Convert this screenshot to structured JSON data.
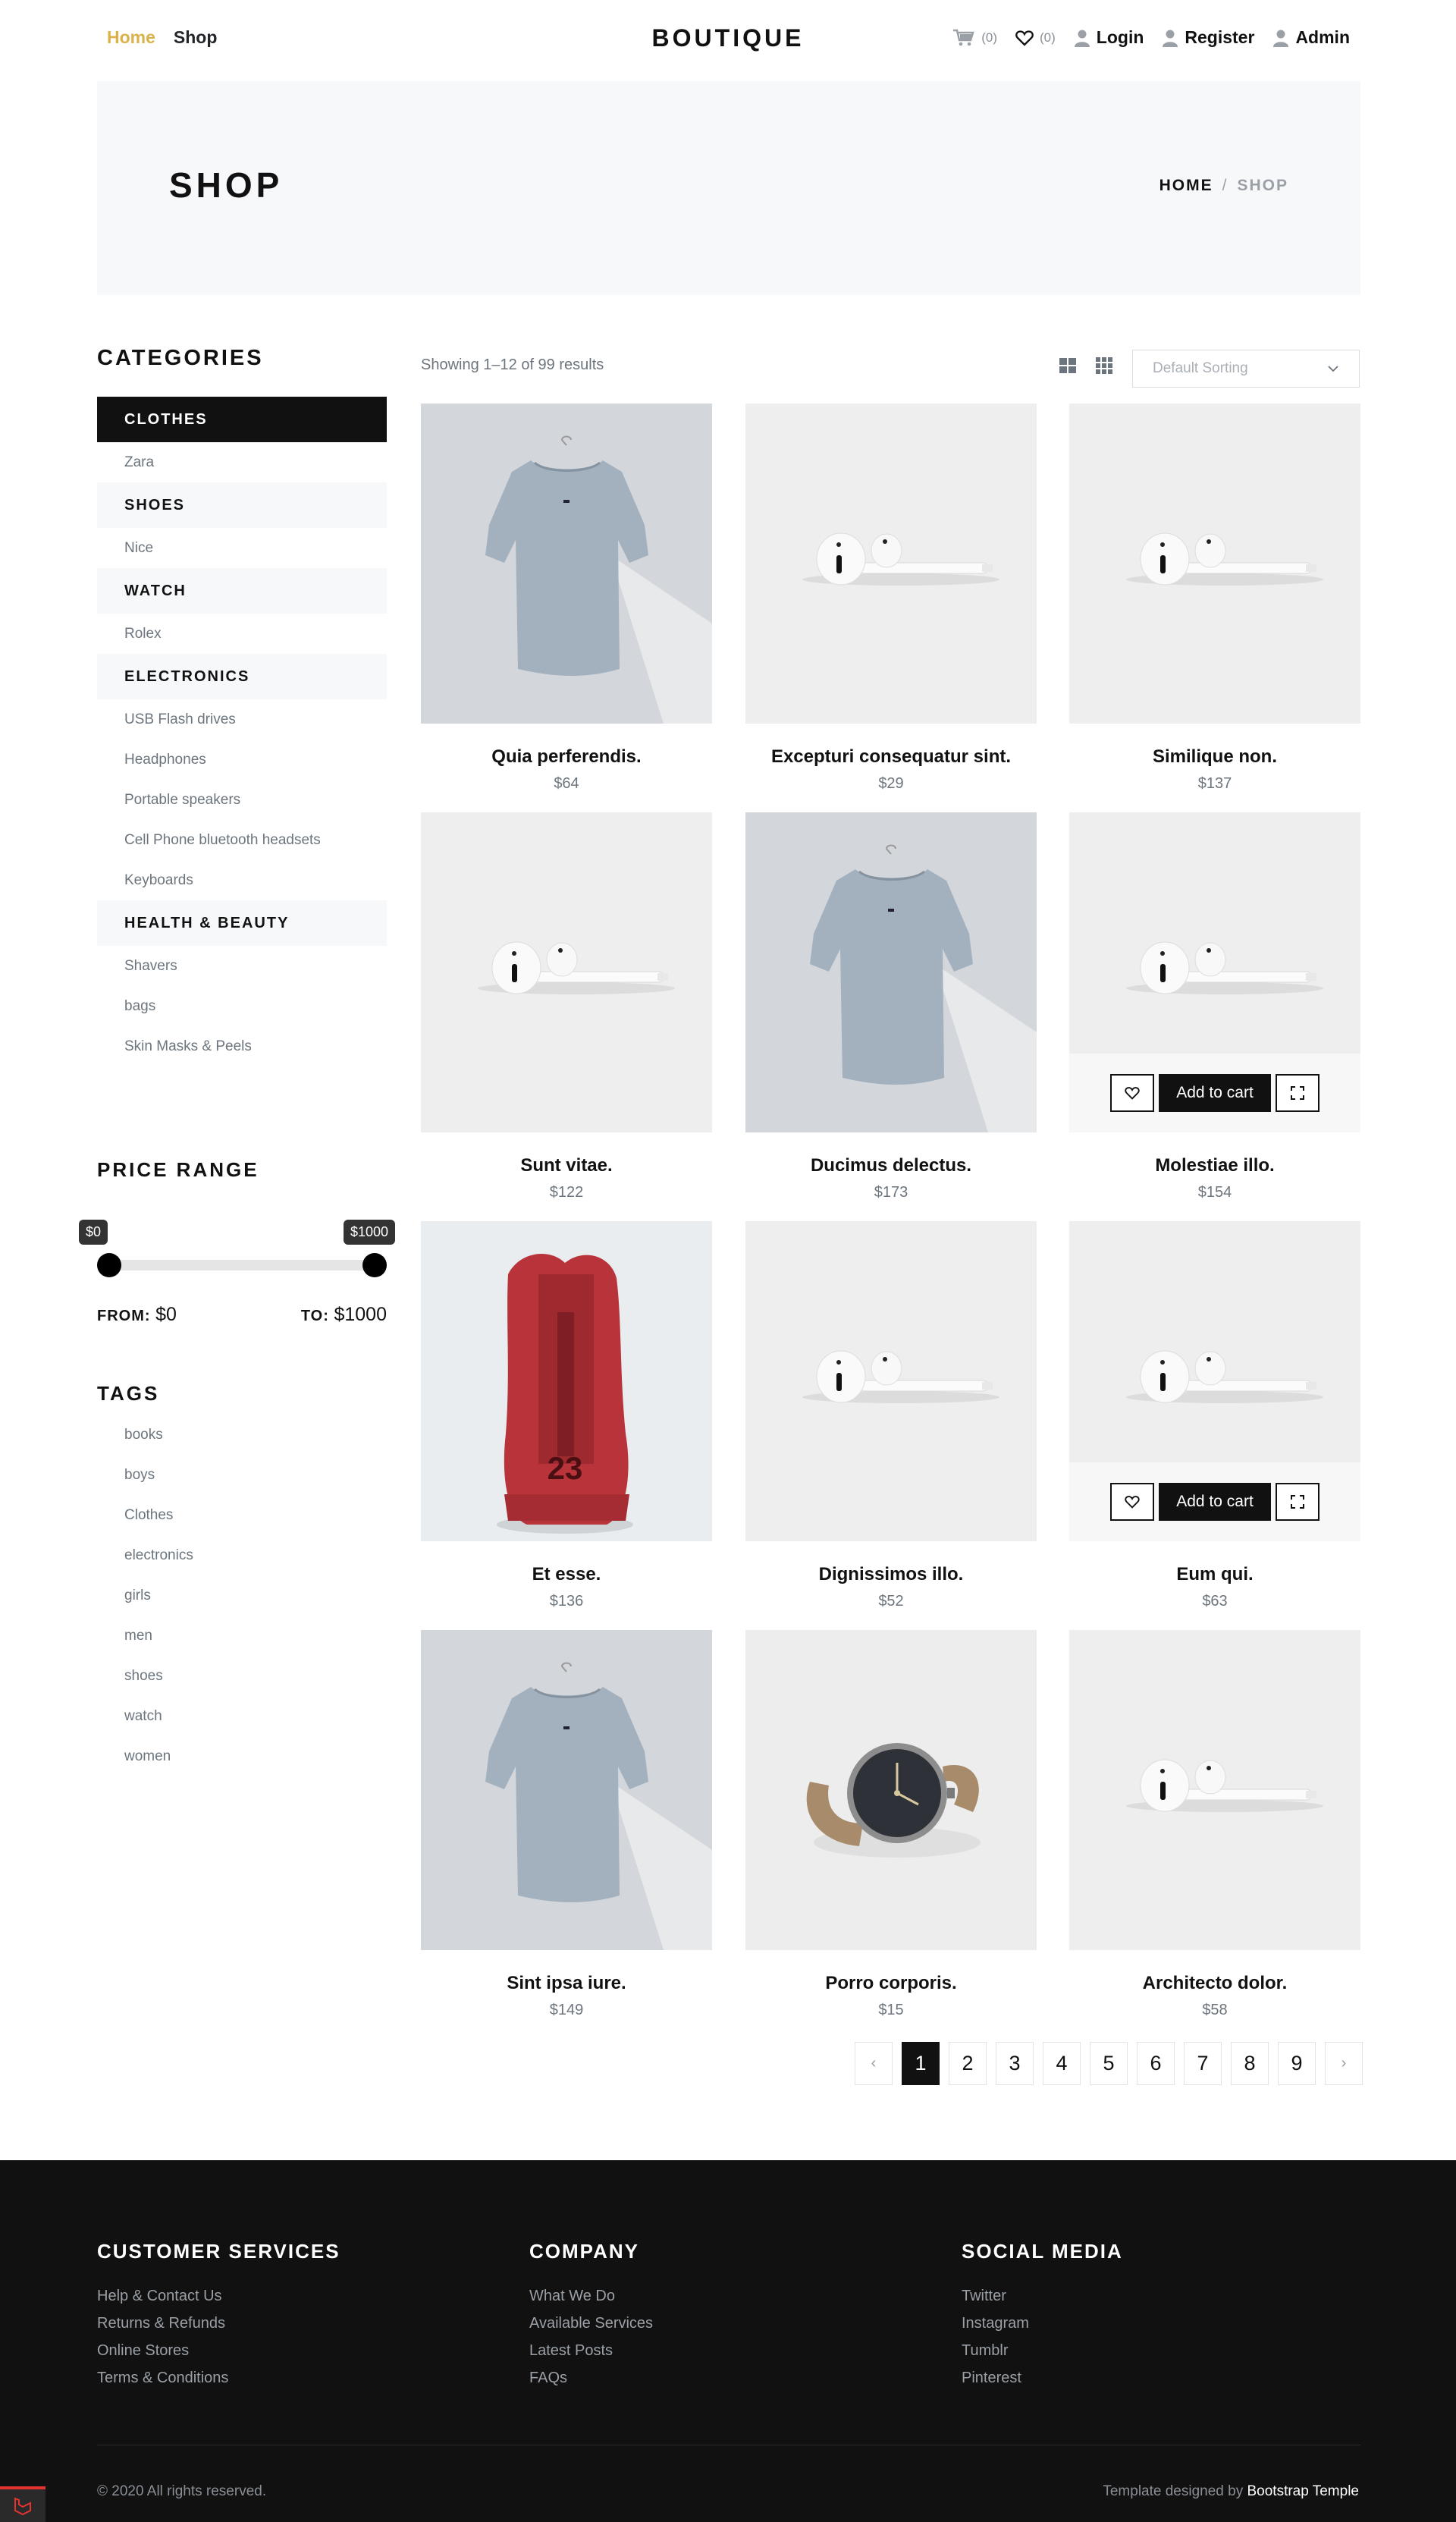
{
  "nav": {
    "home": "Home",
    "shop": "Shop",
    "brand": "BOUTIQUE",
    "cart_count": "(0)",
    "wishlist_count": "(0)",
    "login": "Login",
    "register": "Register",
    "admin": "Admin",
    "active_color": "#dcb14a"
  },
  "hero": {
    "title": "SHOP",
    "crumb_home": "HOME",
    "crumb_sep": "/",
    "crumb_current": "SHOP"
  },
  "sidebar": {
    "categories_title": "CATEGORIES",
    "categories": [
      {
        "name": "CLOTHES",
        "active": true,
        "subs": [
          "Zara"
        ]
      },
      {
        "name": "SHOES",
        "active": false,
        "subs": [
          "Nice"
        ]
      },
      {
        "name": "WATCH",
        "active": false,
        "subs": [
          "Rolex"
        ]
      },
      {
        "name": "ELECTRONICS",
        "active": false,
        "subs": [
          "USB Flash drives",
          "Headphones",
          "Portable speakers",
          "Cell Phone bluetooth headsets",
          "Keyboards"
        ]
      },
      {
        "name": "HEALTH & BEAUTY",
        "active": false,
        "subs": [
          "Shavers",
          "bags",
          "Skin Masks & Peels"
        ]
      }
    ],
    "price_title": "PRICE RANGE",
    "price_min_tip": "$0",
    "price_max_tip": "$1000",
    "from_label": "FROM:",
    "from_value": "$0",
    "to_label": "TO:",
    "to_value": "$1000",
    "range_low": 0,
    "range_high": 1000,
    "tags_title": "TAGS",
    "tags": [
      "books",
      "boys",
      "Clothes",
      "electronics",
      "girls",
      "men",
      "shoes",
      "watch",
      "women"
    ]
  },
  "toolbar": {
    "results": "Showing 1–12 of 99 results",
    "sort_placeholder": "Default Sorting",
    "view_icons": [
      "grid-large-icon",
      "grid-small-icon"
    ]
  },
  "products": [
    {
      "name": "Quia perferendis.",
      "price": "$64",
      "img": "tshirt"
    },
    {
      "name": "Excepturi consequatur sint.",
      "price": "$29",
      "img": "airpods"
    },
    {
      "name": "Similique non.",
      "price": "$137",
      "img": "airpods"
    },
    {
      "name": "Sunt vitae.",
      "price": "$122",
      "img": "airpods"
    },
    {
      "name": "Ducimus delectus.",
      "price": "$173",
      "img": "tshirt"
    },
    {
      "name": "Molestiae illo.",
      "price": "$154",
      "img": "airpods",
      "hover": true
    },
    {
      "name": "Et esse.",
      "price": "$136",
      "img": "sneaker"
    },
    {
      "name": "Dignissimos illo.",
      "price": "$52",
      "img": "airpods"
    },
    {
      "name": "Eum qui.",
      "price": "$63",
      "img": "airpods",
      "hover": true
    },
    {
      "name": "Sint ipsa iure.",
      "price": "$149",
      "img": "tshirt"
    },
    {
      "name": "Porro corporis.",
      "price": "$15",
      "img": "watch"
    },
    {
      "name": "Architecto dolor.",
      "price": "$58",
      "img": "airpods"
    }
  ],
  "card_actions": {
    "add_to_cart": "Add to cart"
  },
  "pagination": {
    "prev": "‹",
    "next": "›",
    "pages": [
      "1",
      "2",
      "3",
      "4",
      "5",
      "6",
      "7",
      "8",
      "9"
    ],
    "current": "1"
  },
  "footer": {
    "col1_title": "CUSTOMER SERVICES",
    "col1_links": [
      "Help & Contact Us",
      "Returns & Refunds",
      "Online Stores",
      "Terms & Conditions"
    ],
    "col2_title": "COMPANY",
    "col2_links": [
      "What We Do",
      "Available Services",
      "Latest Posts",
      "FAQs"
    ],
    "col3_title": "SOCIAL MEDIA",
    "col3_links": [
      "Twitter",
      "Instagram",
      "Tumblr",
      "Pinterest"
    ],
    "copyright": "© 2020 All rights reserved.",
    "credit_prefix": "Template designed by ",
    "credit_link": "Bootstrap Temple"
  }
}
